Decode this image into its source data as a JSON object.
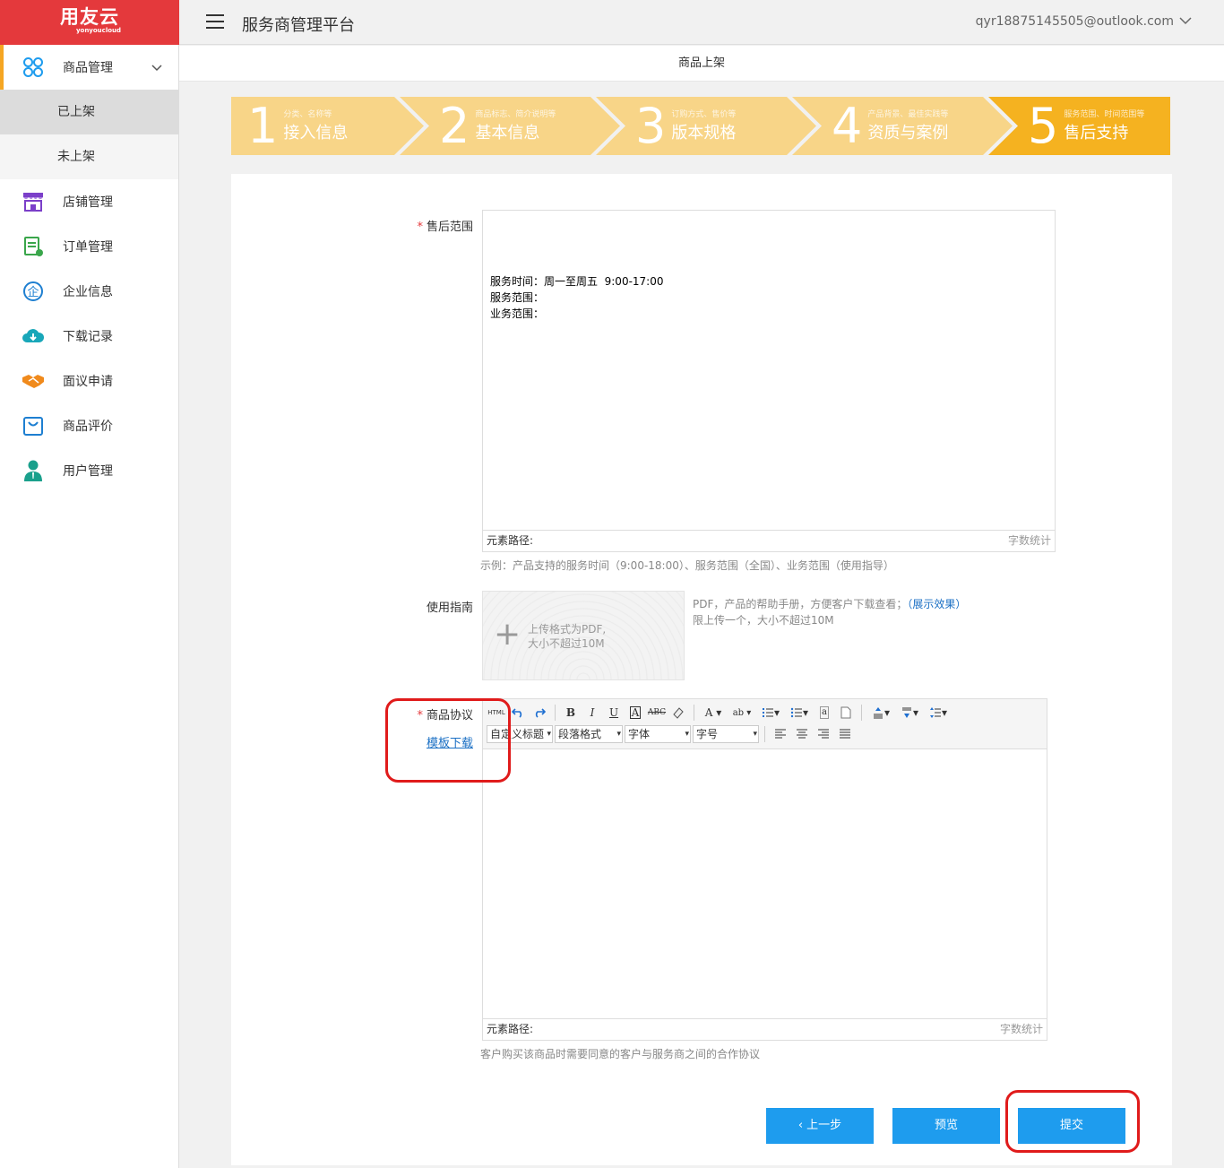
{
  "brand": {
    "cn": "用友云",
    "en": "yonyoucloud"
  },
  "header": {
    "title": "服务商管理平台",
    "user": "qyr18875145505@outlook.com"
  },
  "subheader": {
    "title": "商品上架"
  },
  "sidebar": {
    "items": [
      {
        "label": "商品管理",
        "icon": "grid-icon",
        "color": "#1e9cee"
      },
      {
        "label": "已上架"
      },
      {
        "label": "未上架"
      },
      {
        "label": "店铺管理",
        "icon": "store-icon",
        "color": "#7b3fc9"
      },
      {
        "label": "订单管理",
        "icon": "order-icon",
        "color": "#3aa64b"
      },
      {
        "label": "企业信息",
        "icon": "enterprise-icon",
        "color": "#1e7fd1"
      },
      {
        "label": "下载记录",
        "icon": "cloud-download-icon",
        "color": "#19a7b9"
      },
      {
        "label": "面议申请",
        "icon": "handshake-icon",
        "color": "#f08a1c"
      },
      {
        "label": "商品评价",
        "icon": "bag-icon",
        "color": "#1e7fd1"
      },
      {
        "label": "用户管理",
        "icon": "user-icon",
        "color": "#1aa08c"
      }
    ]
  },
  "steps": [
    {
      "num": "1",
      "hint": "分类、名称等",
      "name": "接入信息"
    },
    {
      "num": "2",
      "hint": "商品标志、简介说明等",
      "name": "基本信息"
    },
    {
      "num": "3",
      "hint": "订购方式、售价等",
      "name": "版本规格"
    },
    {
      "num": "4",
      "hint": "产品背景、最佳实践等",
      "name": "资质与案例"
    },
    {
      "num": "5",
      "hint": "服务范围、时间范围等",
      "name": "售后支持"
    }
  ],
  "colors": {
    "step_inactive": "#f8d588",
    "step_active": "#f5b220",
    "accent": "#1e9cee",
    "brand": "#e4393c",
    "annotation": "#e01b1b"
  },
  "form": {
    "after_sales": {
      "label": "售后范围",
      "content": "服务时间：周一至周五  9:00-17:00\n服务范围：\n业务范围：",
      "path_label": "元素路径:",
      "count_label": "字数统计",
      "help": "示例：产品支持的服务时间（9:00-18:00）、服务范围（全国）、业务范围（使用指导）"
    },
    "guide": {
      "label": "使用指南",
      "upload_line1": "上传格式为PDF,",
      "upload_line2": "大小不超过10M",
      "help_line1": "PDF，产品的帮助手册，方便客户下载查看；",
      "help_link": "（展示效果）",
      "help_line2": "限上传一个，大小不超过10M"
    },
    "agreement": {
      "label": "商品协议",
      "template_link": "模板下载",
      "toolbar": {
        "custom_title": "自定义标题",
        "paragraph": "段落格式",
        "font": "字体",
        "size": "字号"
      },
      "path_label": "元素路径:",
      "count_label": "字数统计",
      "help": "客户购买该商品时需要同意的客户与服务商之间的合作协议"
    }
  },
  "buttons": {
    "prev": "上一步",
    "preview": "预览",
    "submit": "提交"
  }
}
